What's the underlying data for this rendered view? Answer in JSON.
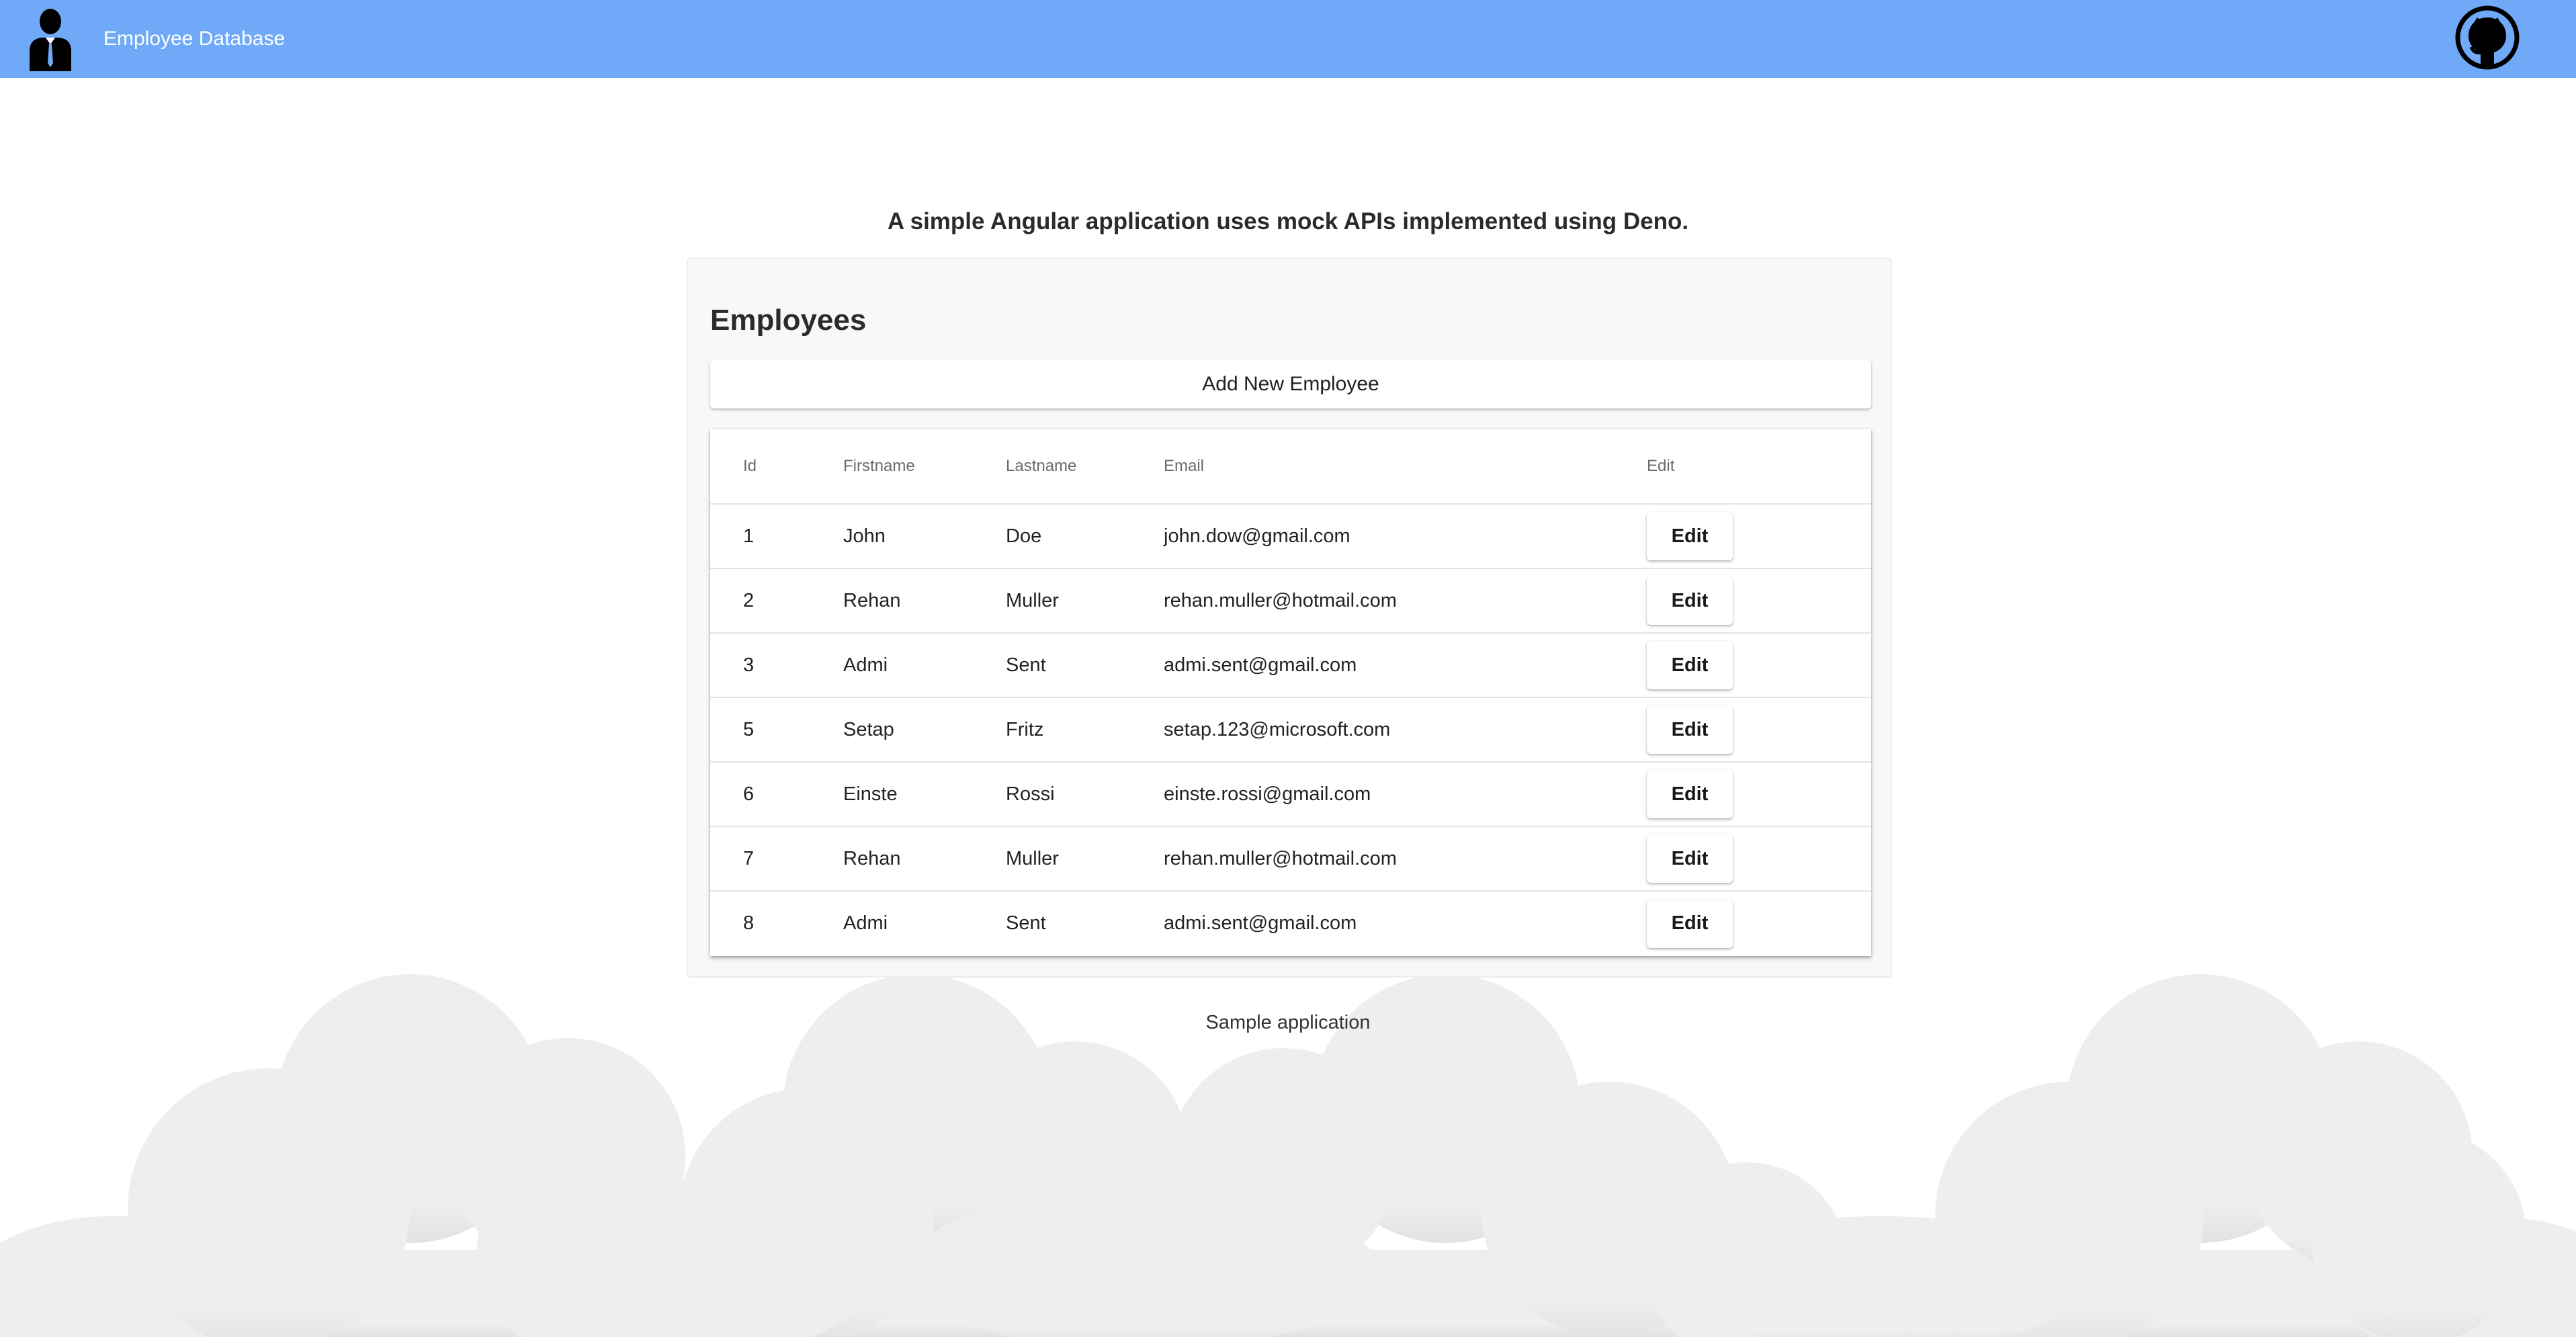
{
  "header": {
    "title": "Employee Database",
    "logo_icon": "employee-person-icon",
    "github_icon": "github-icon",
    "background_color": "#6fa9f8"
  },
  "main": {
    "subtitle": "A simple Angular application uses mock APIs implemented using Deno.",
    "card": {
      "title": "Employees",
      "add_button_label": "Add New Employee"
    },
    "table": {
      "columns": [
        "Id",
        "Firstname",
        "Lastname",
        "Email",
        "Edit"
      ],
      "rows": [
        {
          "id": "1",
          "firstname": "John",
          "lastname": "Doe",
          "email": "john.dow@gmail.com",
          "edit_label": "Edit"
        },
        {
          "id": "2",
          "firstname": "Rehan",
          "lastname": "Muller",
          "email": "rehan.muller@hotmail.com",
          "edit_label": "Edit"
        },
        {
          "id": "3",
          "firstname": "Admi",
          "lastname": "Sent",
          "email": "admi.sent@gmail.com",
          "edit_label": "Edit"
        },
        {
          "id": "5",
          "firstname": "Setap",
          "lastname": "Fritz",
          "email": "setap.123@microsoft.com",
          "edit_label": "Edit"
        },
        {
          "id": "6",
          "firstname": "Einste",
          "lastname": "Rossi",
          "email": "einste.rossi@gmail.com",
          "edit_label": "Edit"
        },
        {
          "id": "7",
          "firstname": "Rehan",
          "lastname": "Muller",
          "email": "rehan.muller@hotmail.com",
          "edit_label": "Edit"
        },
        {
          "id": "8",
          "firstname": "Admi",
          "lastname": "Sent",
          "email": "admi.sent@gmail.com",
          "edit_label": "Edit"
        }
      ]
    }
  },
  "footer": {
    "text": "Sample application",
    "background_icon": "clouds-illustration"
  }
}
